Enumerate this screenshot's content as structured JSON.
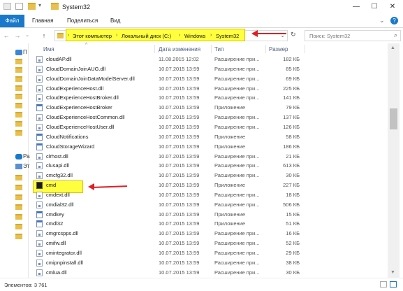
{
  "window": {
    "title": "System32",
    "minimize": "—",
    "maximize": "☐",
    "close": "✕",
    "expand_ribbon": "⌄",
    "help": "?"
  },
  "ribbon": {
    "tabs": [
      "Файл",
      "Главная",
      "Поделиться",
      "Вид"
    ]
  },
  "address": {
    "breadcrumbs": [
      "Этот компьютер",
      "Локальный диск (C:)",
      "Windows",
      "System32"
    ],
    "search_placeholder": "Поиск: System32"
  },
  "sidebar": {
    "items": [
      {
        "label": "П",
        "icon": "star-icon"
      },
      {
        "label": "",
        "icon": "folder-icon"
      },
      {
        "label": "",
        "icon": "folder-icon"
      },
      {
        "label": "",
        "icon": "folder-icon"
      },
      {
        "label": "",
        "icon": "folder-icon"
      },
      {
        "label": "",
        "icon": "folder-icon"
      },
      {
        "label": "",
        "icon": "folder-icon"
      },
      {
        "label": "",
        "icon": "folder-icon"
      },
      {
        "label": "",
        "icon": "folder-icon"
      },
      {
        "label": "",
        "icon": "folder-icon"
      },
      {
        "label": "Ра",
        "icon": "onedrive-icon"
      },
      {
        "label": "Эт",
        "icon": "computer-icon"
      },
      {
        "label": "",
        "icon": "folder-icon"
      },
      {
        "label": "",
        "icon": "folder-icon"
      },
      {
        "label": "",
        "icon": "folder-icon"
      },
      {
        "label": "",
        "icon": "folder-icon"
      },
      {
        "label": "",
        "icon": "folder-icon"
      },
      {
        "label": "",
        "icon": "folder-icon"
      },
      {
        "label": "",
        "icon": "folder-icon"
      }
    ]
  },
  "columns": {
    "name": "Имя",
    "date": "Дата изменения",
    "type": "Тип",
    "size": "Размер"
  },
  "files": [
    {
      "name": "cloudAP.dll",
      "date": "11.08.2015 12:02",
      "type": "Расширение при...",
      "size": "182 КБ",
      "icon": "dll"
    },
    {
      "name": "CloudDomainJoinAUG.dll",
      "date": "10.07.2015 13:59",
      "type": "Расширение при...",
      "size": "85 КБ",
      "icon": "dll"
    },
    {
      "name": "CloudDomainJoinDataModelServer.dll",
      "date": "10.07.2015 13:59",
      "type": "Расширение при...",
      "size": "69 КБ",
      "icon": "dll"
    },
    {
      "name": "CloudExperienceHost.dll",
      "date": "10.07.2015 13:59",
      "type": "Расширение при...",
      "size": "225 КБ",
      "icon": "dll"
    },
    {
      "name": "CloudExperienceHostBroker.dll",
      "date": "10.07.2015 13:59",
      "type": "Расширение при...",
      "size": "141 КБ",
      "icon": "dll"
    },
    {
      "name": "CloudExperienceHostBroker",
      "date": "10.07.2015 13:59",
      "type": "Приложение",
      "size": "79 КБ",
      "icon": "app"
    },
    {
      "name": "CloudExperienceHostCommon.dll",
      "date": "10.07.2015 13:59",
      "type": "Расширение при...",
      "size": "137 КБ",
      "icon": "dll"
    },
    {
      "name": "CloudExperienceHostUser.dll",
      "date": "10.07.2015 13:59",
      "type": "Расширение при...",
      "size": "126 КБ",
      "icon": "dll"
    },
    {
      "name": "CloudNotifications",
      "date": "10.07.2015 13:59",
      "type": "Приложение",
      "size": "58 КБ",
      "icon": "app"
    },
    {
      "name": "CloudStorageWizard",
      "date": "10.07.2015 13:59",
      "type": "Приложение",
      "size": "186 КБ",
      "icon": "app"
    },
    {
      "name": "clrhost.dll",
      "date": "10.07.2015 13:59",
      "type": "Расширение при...",
      "size": "21 КБ",
      "icon": "dll"
    },
    {
      "name": "clusapi.dll",
      "date": "10.07.2015 13:59",
      "type": "Расширение при...",
      "size": "613 КБ",
      "icon": "dll"
    },
    {
      "name": "cmcfg32.dll",
      "date": "10.07.2015 13:59",
      "type": "Расширение при...",
      "size": "30 КБ",
      "icon": "dll"
    },
    {
      "name": "cmd",
      "date": "10.07.2015 13:59",
      "type": "Приложение",
      "size": "227 КБ",
      "icon": "cmd"
    },
    {
      "name": "cmdext.dll",
      "date": "10.07.2015 13:59",
      "type": "Расширение при...",
      "size": "18 КБ",
      "icon": "dll"
    },
    {
      "name": "cmdial32.dll",
      "date": "10.07.2015 13:59",
      "type": "Расширение при...",
      "size": "506 КБ",
      "icon": "dll"
    },
    {
      "name": "cmdkey",
      "date": "10.07.2015 13:59",
      "type": "Приложение",
      "size": "15 КБ",
      "icon": "app"
    },
    {
      "name": "cmdl32",
      "date": "10.07.2015 13:59",
      "type": "Приложение",
      "size": "51 КБ",
      "icon": "app"
    },
    {
      "name": "cmgrcspps.dll",
      "date": "10.07.2015 13:59",
      "type": "Расширение при...",
      "size": "16 КБ",
      "icon": "dll"
    },
    {
      "name": "cmifw.dll",
      "date": "10.07.2015 13:59",
      "type": "Расширение при...",
      "size": "52 КБ",
      "icon": "dll"
    },
    {
      "name": "cmintegrator.dll",
      "date": "10.07.2015 13:59",
      "type": "Расширение при...",
      "size": "29 КБ",
      "icon": "dll"
    },
    {
      "name": "cmipnpinstall.dll",
      "date": "10.07.2015 13:59",
      "type": "Расширение при...",
      "size": "38 КБ",
      "icon": "dll"
    },
    {
      "name": "cmlua.dll",
      "date": "10.07.2015 13:59",
      "type": "Расширение при...",
      "size": "30 КБ",
      "icon": "dll"
    }
  ],
  "status": {
    "item_count": "Элементов: 3 761"
  },
  "colors": {
    "highlight": "#ffff3d",
    "arrow": "#dd1f26",
    "file_tab": "#1979ca"
  }
}
